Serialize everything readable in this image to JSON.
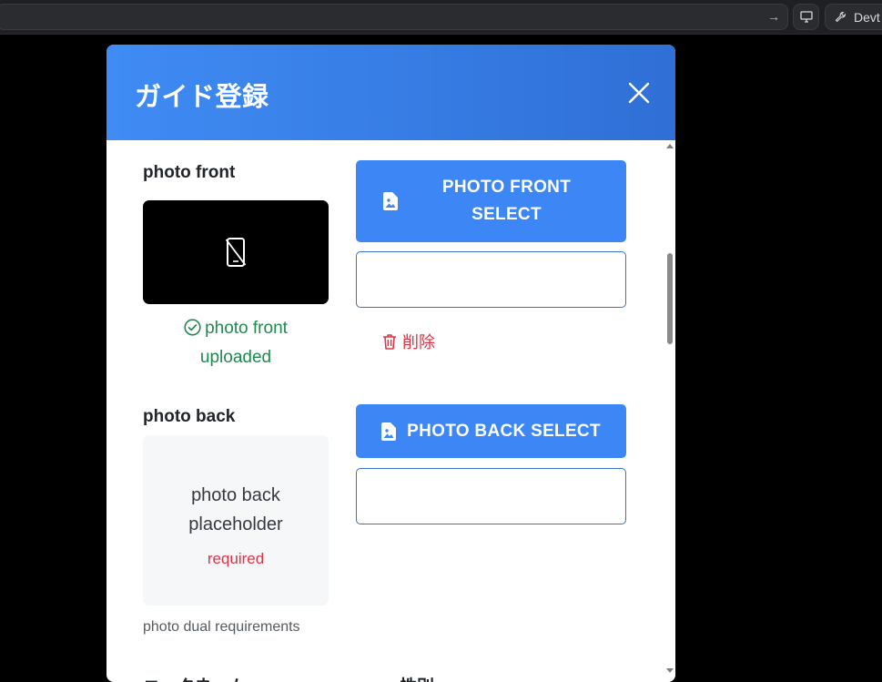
{
  "browser": {
    "devtools_label": "Devt"
  },
  "modal": {
    "title": "ガイド登録"
  },
  "photo_front": {
    "label": "photo front",
    "select_button": "PHOTO FRONT SELECT",
    "select_line1": "PHOTO FRONT",
    "select_line2": "SELECT",
    "status_line1": "photo front",
    "status_line2": "uploaded",
    "delete_label": "削除"
  },
  "photo_back": {
    "label": "photo back",
    "select_button": "PHOTO BACK SELECT",
    "placeholder_line1": "photo back",
    "placeholder_line2": "placeholder",
    "required": "required",
    "requirements_hint": "photo dual requirements"
  },
  "next_section": {
    "left_label_partial": "ニックネーム",
    "right_label_partial": "性別"
  },
  "colors": {
    "header_start": "#3f8cf4",
    "header_end": "#2f6fd6",
    "primary": "#3d86f5",
    "success": "#1f8a4c",
    "danger": "#dc3545"
  }
}
